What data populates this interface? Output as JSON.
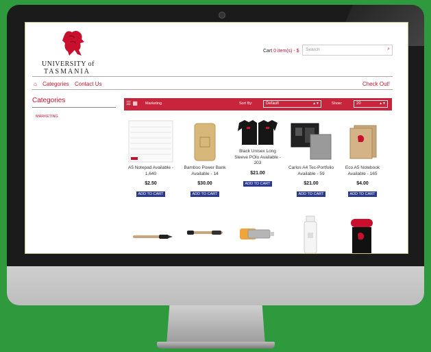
{
  "logo": {
    "line1": "UNIVERSITY of",
    "line2": "TASMANIA"
  },
  "header": {
    "cart_label": "Cart ",
    "cart_count": "0 item(s) - $",
    "search_placeholder": "Search"
  },
  "nav": {
    "categories": "Categories",
    "contact": "Contact Us",
    "checkout": "Check Out!"
  },
  "sidebar": {
    "title": "Categories",
    "item": "MARKETING"
  },
  "toolbar": {
    "category": "Marketing",
    "sort_by_label": "Sort By:",
    "sort_by_value": "Default",
    "show_label": "Show:",
    "show_value": "20"
  },
  "products": [
    {
      "name": "A5 Notepad Available - 1,640",
      "price": "$2.50",
      "button": "ADD TO CART"
    },
    {
      "name": "Bamboo Power Bank Available - 14",
      "price": "$30.00",
      "button": "ADD TO CART"
    },
    {
      "name": "Black Unisex Long Sleeve POlo Available - 203",
      "price": "$21.00",
      "button": "ADD TO CART"
    },
    {
      "name": "Carlos A4 Tec-Portfolio Available - 59",
      "price": "$21.00",
      "button": "ADD TO CART"
    },
    {
      "name": "Eco A5 Notebook Available - 165",
      "price": "$4.00",
      "button": "ADD TO CART"
    }
  ],
  "colors": {
    "accent": "#c8102e",
    "button": "#2b3a8f",
    "background": "#2f9a3d"
  }
}
